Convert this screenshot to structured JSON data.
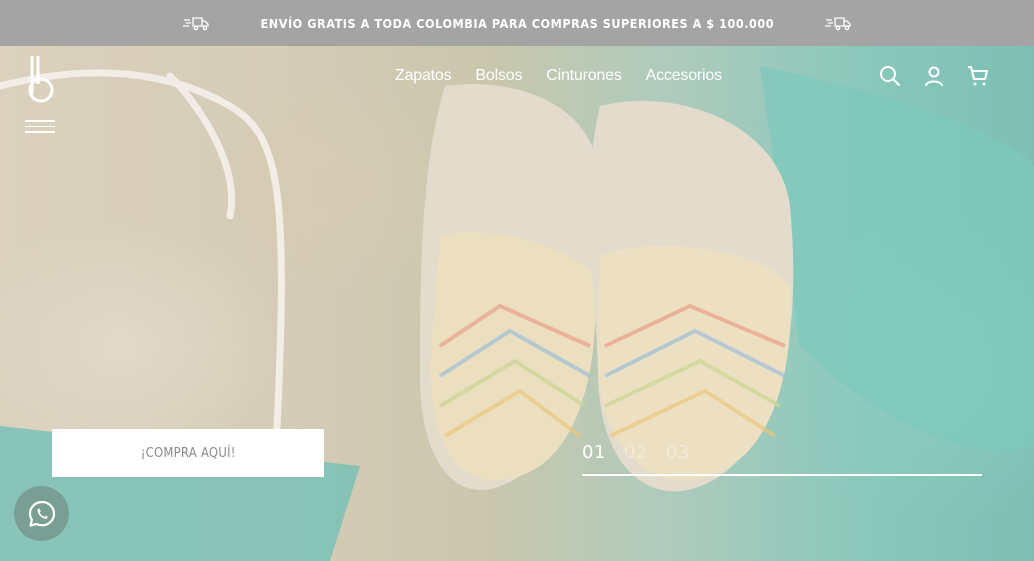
{
  "announcement": {
    "text": "ENVÍO GRATIS A TODA COLOMBIA PARA COMPRAS SUPERIORES A $ 100.000",
    "left_icon": "delivery-truck-icon",
    "right_icon": "delivery-truck-icon"
  },
  "brand": {
    "logo_letter": "b"
  },
  "nav": {
    "items": [
      {
        "label": "Zapatos"
      },
      {
        "label": "Bolsos"
      },
      {
        "label": "Cinturones"
      },
      {
        "label": "Accesorios"
      }
    ]
  },
  "header_icons": [
    "search-icon",
    "user-icon",
    "cart-icon"
  ],
  "hero": {
    "cta_label": "¡COMPRA AQUÍ!",
    "slides": [
      "01",
      "02",
      "03"
    ],
    "active_slide": "01"
  },
  "floating": {
    "icon": "whatsapp-icon"
  },
  "colors": {
    "topbar": "#a4a4a4",
    "text_light": "#ffffff",
    "cta_text": "#8a8a8a"
  }
}
